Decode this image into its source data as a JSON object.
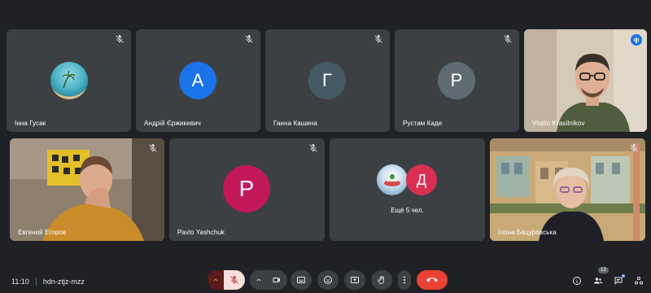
{
  "participants_row1": [
    {
      "name": "Інна Гусак",
      "type": "image"
    },
    {
      "name": "Андрій Єржикевич",
      "initial": "А",
      "color": "#1a73e8"
    },
    {
      "name": "Ганна Кашина",
      "initial": "Г",
      "color": "#455a64"
    },
    {
      "name": "Рустам Каде",
      "initial": "Р",
      "color": "#5f6b73"
    },
    {
      "name": "Vitalio Krasilnikov",
      "type": "video",
      "speaking": true
    }
  ],
  "participants_row2": [
    {
      "name": "Евгений Егоров",
      "type": "video"
    },
    {
      "name": "Pavlo Yashchuk",
      "initial": "P",
      "color": "#c2185b"
    },
    {
      "others_label": "Ещё 5 чел.",
      "initial": "Д",
      "color": "#d93051"
    },
    {
      "name": "Ілона Бацуровська",
      "type": "video"
    }
  ],
  "meeting": {
    "time": "11:10",
    "code": "hdn-ztjz-mzz"
  },
  "people_count": "13",
  "colors": {
    "background": "#202124",
    "tile": "#3c4043",
    "end_call": "#ea4335",
    "mic_off_bg": "#f9dedc",
    "accent": "#1a73e8"
  },
  "icons": [
    "mic-off-icon",
    "camera-icon",
    "captions-icon",
    "emoji-icon",
    "present-icon",
    "raise-hand-icon",
    "more-icon",
    "end-call-icon",
    "info-icon",
    "people-icon",
    "chat-icon",
    "activities-icon"
  ]
}
